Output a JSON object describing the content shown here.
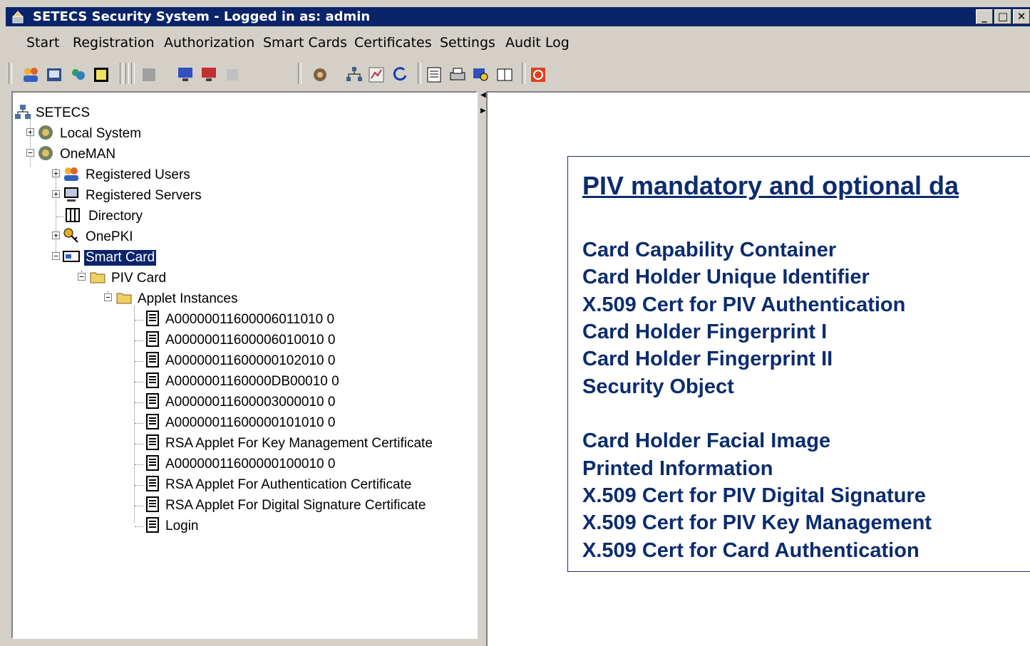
{
  "window": {
    "title": "SETECS Security System - Logged in as: admin"
  },
  "menu": [
    "Start",
    "Registration",
    "Authorization",
    "Smart Cards",
    "Certificates",
    "Settings",
    "Audit Log"
  ],
  "toolbar": {
    "icons": [
      "users-icon",
      "registration-icon",
      "group-icon",
      "card-icon",
      "disabled-icon",
      "monitor-icon",
      "monitor-red-icon",
      "disabled-icon-2",
      "key-icon",
      "network-icon",
      "chart-icon",
      "refresh-icon",
      "log-icon",
      "print-icon",
      "search-icon",
      "book-icon",
      "power-icon"
    ]
  },
  "tree": {
    "root": "SETECS",
    "local_system": "Local System",
    "oneman": "OneMAN",
    "registered_users": "Registered Users",
    "registered_servers": "Registered Servers",
    "directory": "Directory",
    "onepki": "OnePKI",
    "smart_card": "Smart Card",
    "piv_card": "PIV Card",
    "applet_instances": "Applet Instances",
    "applets": [
      "A00000011600006011010 0",
      "A00000011600006010010 0",
      "A00000011600000102010 0",
      "A0000001160000DB00010 0",
      "A00000011600003000010 0",
      "A00000011600000101010 0",
      "RSA Applet For Key Management Certificate",
      "A00000011600000100010 0",
      "RSA Applet For Authentication Certificate",
      "RSA Applet For Digital Signature Certificate",
      "Login"
    ]
  },
  "info": {
    "title": "PIV mandatory and optional da",
    "mandatory": [
      "Card Capability Container",
      "Card Holder Unique Identifier",
      "X.509 Cert for PIV Authentication",
      "Card Holder Fingerprint I",
      "Card Holder Fingerprint II",
      "Security Object"
    ],
    "optional": [
      "Card Holder Facial Image",
      "Printed Information",
      "X.509 Cert for PIV Digital Signature",
      "X.509 Cert for PIV Key Management",
      "X.509 Cert for Card Authentication"
    ]
  },
  "colors": {
    "titlebar": "#0a246a",
    "info_text": "#0c2c6e",
    "selection": "#0a246a"
  }
}
